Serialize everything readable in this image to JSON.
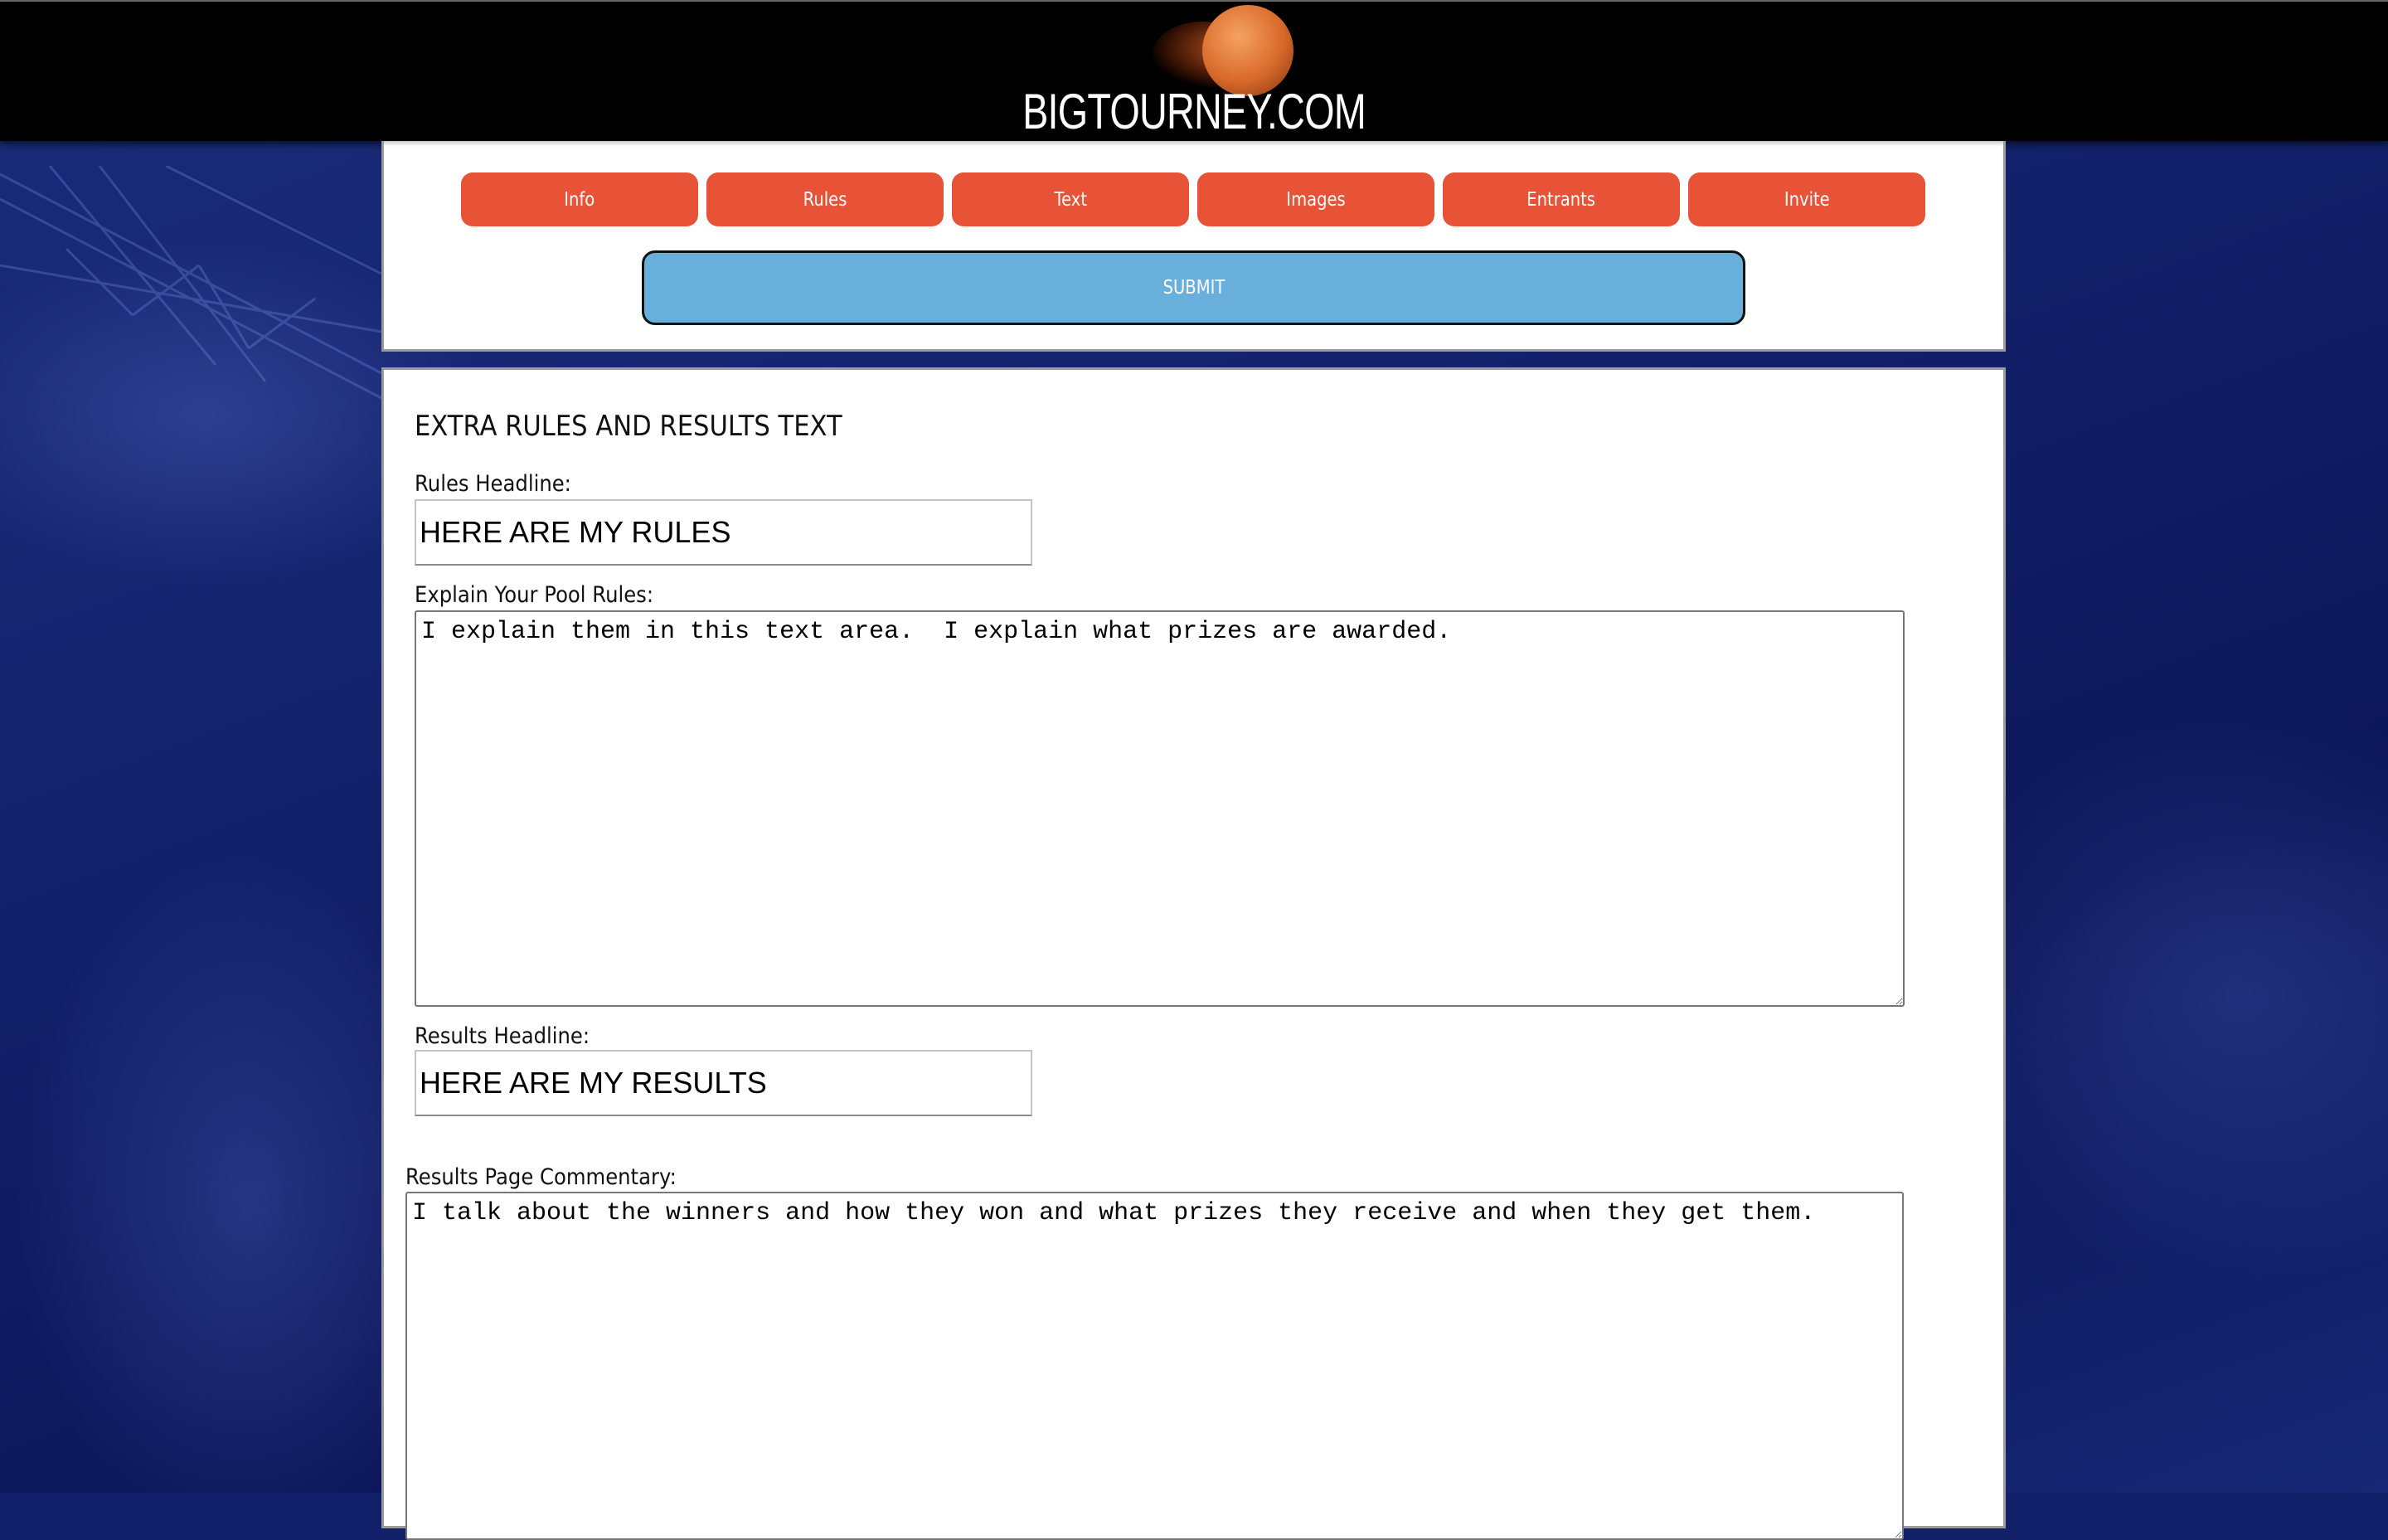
{
  "site": {
    "logo_text": "BIGTOURNEY.COM",
    "logo_icon": "basketball-icon"
  },
  "nav": {
    "tabs": [
      {
        "label": "Info"
      },
      {
        "label": "Rules"
      },
      {
        "label": "Text"
      },
      {
        "label": "Images"
      },
      {
        "label": "Entrants"
      },
      {
        "label": "Invite"
      }
    ],
    "submit_label": "SUBMIT"
  },
  "colors": {
    "nav_button": "#e85236",
    "submit_button": "#69afdb",
    "header": "#000000",
    "background": "#12206a"
  },
  "form": {
    "section_title": "EXTRA RULES AND RESULTS TEXT",
    "rules_headline": {
      "label": "Rules Headline:",
      "value": "HERE ARE MY RULES"
    },
    "pool_rules": {
      "label": "Explain Your Pool Rules:",
      "value": "I explain them in this text area.  I explain what prizes are awarded."
    },
    "results_headline": {
      "label": "Results Headline:",
      "value": "HERE ARE MY RESULTS"
    },
    "results_commentary": {
      "label": "Results Page Commentary:",
      "value": "I talk about the winners and how they won and what prizes they receive and when they get them."
    }
  }
}
